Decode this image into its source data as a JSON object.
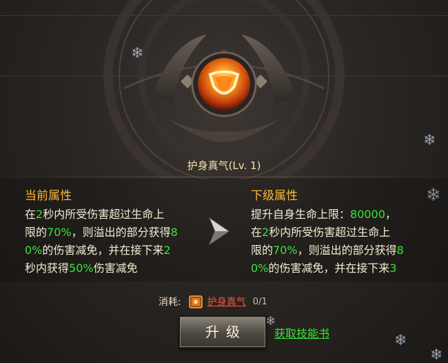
{
  "skill": {
    "name": "护身真气",
    "level_text": "(Lv. 1)"
  },
  "current": {
    "heading": "当前属性",
    "lines": [
      [
        {
          "t": "在"
        },
        {
          "t": "2",
          "g": true
        },
        {
          "t": "秒内所受伤害超过生命上"
        }
      ],
      [
        {
          "t": "限的"
        },
        {
          "t": "70%",
          "g": true
        },
        {
          "t": "，则溢出的部分获得"
        },
        {
          "t": "8",
          "g": true
        }
      ],
      [
        {
          "t": "0%",
          "g": true
        },
        {
          "t": "的伤害减免，并在接下来"
        },
        {
          "t": "2",
          "g": true
        }
      ],
      [
        {
          "t": "秒内获得"
        },
        {
          "t": "50%",
          "g": true
        },
        {
          "t": "伤害减免"
        }
      ]
    ]
  },
  "next": {
    "heading": "下级属性",
    "lines": [
      [
        {
          "t": "提升自身生命上限："
        },
        {
          "t": "80000",
          "g": true
        },
        {
          "t": "，"
        }
      ],
      [
        {
          "t": "在"
        },
        {
          "t": "2",
          "g": true
        },
        {
          "t": "秒内所受伤害超过生命上"
        }
      ],
      [
        {
          "t": "限的"
        },
        {
          "t": "70%",
          "g": true
        },
        {
          "t": "，则溢出的部分获得"
        },
        {
          "t": "8",
          "g": true
        }
      ],
      [
        {
          "t": "0%",
          "g": true
        },
        {
          "t": "的伤害减免，并在接下来"
        },
        {
          "t": "3",
          "g": true
        }
      ]
    ]
  },
  "cost": {
    "label": "消耗:",
    "item_name": "护身真气",
    "count": "0/1"
  },
  "upgrade_button": "升级",
  "get_book_link": "获取技能书",
  "colors": {
    "highlight_green": "#38e53a",
    "heading_orange": "#ffb73a",
    "link_red": "#ff4e3a"
  }
}
